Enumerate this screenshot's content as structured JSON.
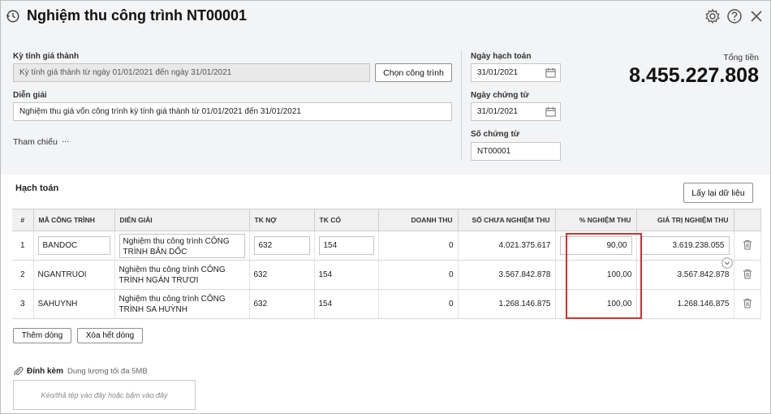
{
  "header": {
    "title": "Nghiệm thu công trình NT00001",
    "icons": [
      "history-icon",
      "gear-icon",
      "help-icon",
      "close-icon"
    ]
  },
  "form": {
    "ky_tinh_gia_thanh_label": "Kỳ tính giá thành",
    "ky_tinh_gia_thanh_value": "Kỳ tính giá thành từ ngày 01/01/2021 đến ngày 31/01/2021",
    "chon_cong_trinh_label": "Chọn công trình",
    "dien_giai_label": "Diễn giải",
    "dien_giai_value": "Nghiệm thu giá vốn công trình kỳ tính giá thành từ 01/01/2021 đến 31/01/2021",
    "tham_chieu_label": "Tham chiếu",
    "tham_chieu_more": "...",
    "ngay_hach_toan_label": "Ngày hạch toán",
    "ngay_hach_toan_value": "31/01/2021",
    "ngay_chung_tu_label": "Ngày chứng từ",
    "ngay_chung_tu_value": "31/01/2021",
    "so_chung_tu_label": "Số chứng từ",
    "so_chung_tu_value": "NT00001",
    "tong_tien_label": "Tổng tiền",
    "tong_tien_value": "8.455.227.808"
  },
  "hach_toan": {
    "title": "Hạch toán",
    "reload_label": "Lấy lại dữ liệu",
    "columns": [
      "#",
      "MÃ CÔNG TRÌNH",
      "DIỄN GIẢI",
      "TK NỢ",
      "TK CÓ",
      "DOANH THU",
      "SỐ CHƯA NGHIỆM THU",
      "% NGHIỆM THU",
      "GIÁ TRỊ NGHIỆM THU"
    ],
    "rows": [
      {
        "stt": "1",
        "ma": "BANDOC",
        "dien_giai": "Nghiệm thu công trình CÔNG TRÌNH BẢN DỐC",
        "tk_no": "632",
        "tk_co": "154",
        "doanh_thu": "0",
        "so_chua": "4.021.375.617",
        "phan_tram": "90,00",
        "gia_tri": "3.619.238.055"
      },
      {
        "stt": "2",
        "ma": "NGANTRUOI",
        "dien_giai": "Nghiệm thu công trình CÔNG TRÌNH NGÀN TRƯƠI",
        "tk_no": "632",
        "tk_co": "154",
        "doanh_thu": "0",
        "so_chua": "3.567.842.878",
        "phan_tram": "100,00",
        "gia_tri": "3.567.842.878"
      },
      {
        "stt": "3",
        "ma": "SAHUYNH",
        "dien_giai": "Nghiệm thu công trình CÔNG TRÌNH SA HUỲNH",
        "tk_no": "632",
        "tk_co": "154",
        "doanh_thu": "0",
        "so_chua": "1.268.146.875",
        "phan_tram": "100,00",
        "gia_tri": "1.268.146.875"
      }
    ],
    "add_row_label": "Thêm dòng",
    "delete_all_label": "Xóa hết dòng"
  },
  "attachment": {
    "label": "Đính kèm",
    "limit": "Dung lượng tối đa 5MB",
    "dropzone_text": "Kéo/thả tệp vào đây hoặc bấm vào đây"
  },
  "colors": {
    "highlight": "#d32f2f",
    "header_bg": "#f3f4f6"
  }
}
